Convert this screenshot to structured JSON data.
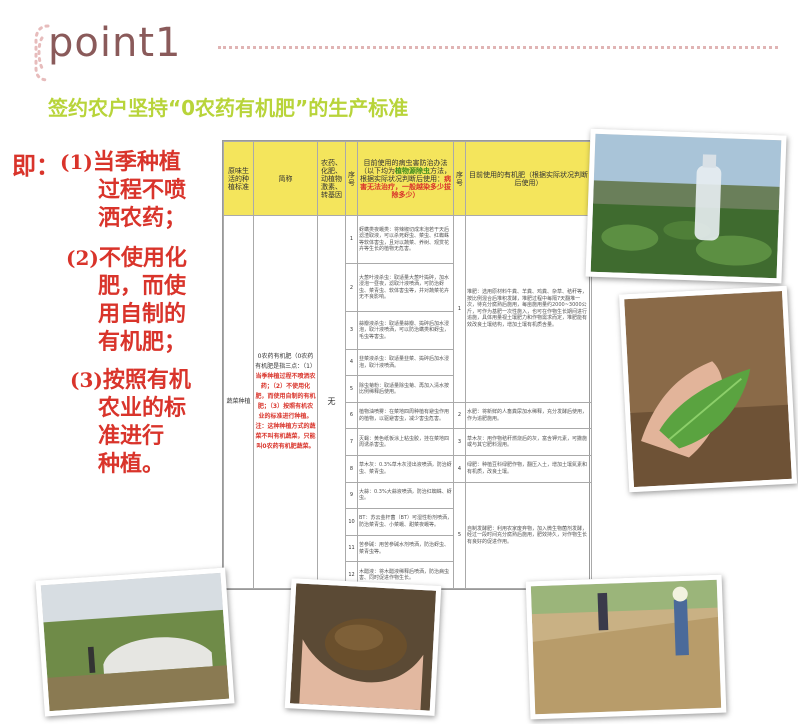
{
  "header": {
    "badge": "point1",
    "subtitle": "签约农户坚持“0农药有机肥”的生产标准"
  },
  "left_list": {
    "lead": "即：",
    "items": [
      {
        "num": "(1)",
        "text_1": "当季种植",
        "text_2": "过程不喷",
        "text_3": "洒农药；"
      },
      {
        "num": "(2)",
        "text_1": "不使用化",
        "text_2": "肥，而使",
        "text_3": "用自制的",
        "text_4": "有机肥；"
      },
      {
        "num": "(3)",
        "text_1": "按照有机",
        "text_2": "农业的标",
        "text_3": "准进行",
        "text_4": "种植。"
      }
    ]
  },
  "table": {
    "headers": {
      "col1": "原味生活的种植标准",
      "col2": "简称",
      "col3": "农药、化肥、动植物激素、转基因",
      "col4": "序号",
      "col5_a": "目前使用的病虫害防治办法",
      "col5_b": "（以下均为",
      "col5_c": "植物源除虫",
      "col5_d": "方法，根据实际状况判断后使用：",
      "col5_e": "病害无法治疗，一般越染多少拔除多少）",
      "col6": "序号",
      "col7_a": "目前使用的有机肥",
      "col7_b": "（根据实际状况判断后使用）"
    },
    "row_label": "蔬菜种植",
    "main_text": {
      "a": "0农药有机肥（0农药有机肥是指三点：（1）",
      "b": "当季种植过程不喷洒农药；（2）不使用化肥，而使用自制的有机肥；（3）按照有机农业的标准进行种植。",
      "c": "注：这种种植方式的蔬菜不叫有机蔬菜，只能叫0农药有机肥蔬菜。"
    },
    "none_mark": "无",
    "pest_rows": [
      {
        "n": "1",
        "t": "蚜螨类夜蛾类：将辣椒切成末泡若干天后滤渣取液，可以杀死蚜虫、菜虫、红蜘蛛等软体害虫，且对以蔬菜、养树、观赏花卉等生长的植物无危害。"
      },
      {
        "n": "2",
        "t": "大葱叶液杀虫：取适量大葱叶捣碎，加水浸泡一昼夜，滤取汁液喷洒，可防治蚜虫、菜青虫、软体害虫等，并对蔬菜花卉无不良影响。"
      },
      {
        "n": "3",
        "t": "蒜瓣液杀虫：取适量蒜瓣、捣碎后加水浸泡，取汁液喷洒，可以防治螨类和蚜虫，毛虫等害虫。"
      },
      {
        "n": "4",
        "t": "韭菜液杀虫：取适量韭菜、捣碎后加水浸泡，取汁液喷洒。"
      },
      {
        "n": "5",
        "t": "除虫菊粉：取适量除虫菊、再加入清水按比例稀释后使用。"
      },
      {
        "n": "6",
        "t": "植物油喷雾：在菜地四周种植有避虫作用的植物，以驱避害虫，减少害虫危害。"
      },
      {
        "n": "7",
        "t": "灭蝇：黄色纸板涂上粘虫胶，挂在菜地四周诱杀害虫。"
      },
      {
        "n": "8",
        "t": "草木灰：0.3%草木灰浸出液喷洒，防治蚜虫、菜青虫。"
      },
      {
        "n": "9",
        "t": "大蒜：0.3%大蒜液喷洒，防治红蜘蛛、蚜虫。"
      },
      {
        "n": "10",
        "t": "BT：苏云金杆菌（BT）可湿性粉剂喷洒，防治菜青虫、小菜蛾、甜菜夜蛾等。"
      },
      {
        "n": "11",
        "t": "苦参碱：用苦参碱水剂喷洒，防治蚜虫、菜青虫等。"
      },
      {
        "n": "12",
        "t": "木醋液：将木醋液稀释后喷洒，防治病虫害、同时促进作物生长。"
      }
    ],
    "fert_rows": [
      {
        "n": "1",
        "t": "堆肥：选用原材料牛粪、羊粪、鸡粪、杂草、秸秆等，按比例混合后堆积发酵，堆肥过程中每隔7天翻堆一次，待充分腐熟后施用，每亩施用量约2000~3000公斤，可作为基肥一次性施入，也可在作物生长期间进行追施，具体用量视土壤肥力和作物需求而定，堆肥能有效改良土壤结构，增加土壤有机质含量。"
      },
      {
        "n": "2",
        "t": "水肥：将新鲜的人畜粪尿加水稀释，充分发酵后使用，作为追肥施用。"
      },
      {
        "n": "3",
        "t": "草木灰：用作物秸秆燃烧后的灰，富含钾元素，可撒施或与其它肥料混用。"
      },
      {
        "n": "4",
        "t": "绿肥：种植豆科绿肥作物，翻压入土，增加土壤氮素和有机质，改良土壤。"
      },
      {
        "n": "5",
        "t": "自制发酵肥：利用农家废弃物，加入微生物菌剂发酵，经过一段时间充分腐熟后施用，肥效持久，对作物生长有良好的促进作用。"
      }
    ]
  },
  "photos": {
    "p1": "bottle-in-field-photo",
    "p2": "leaf-in-hand-photo",
    "p3": "compost-heap-photo",
    "p4": "compost-in-hand-photo",
    "p5": "farmers-spreading-straw-photo"
  }
}
